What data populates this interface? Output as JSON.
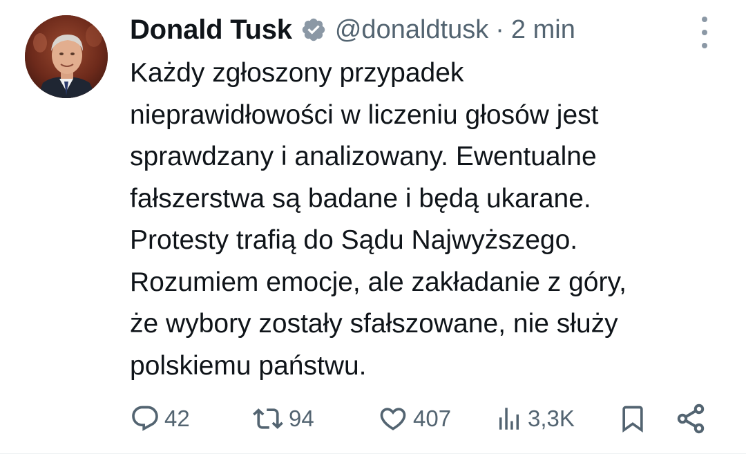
{
  "author": {
    "display_name": "Donald Tusk",
    "handle": "@donaldtusk",
    "separator": "·",
    "time": "2 min",
    "avatar_icon": "profile-photo",
    "verified_icon": "verified-badge-icon",
    "verified_color": "#8b98a5"
  },
  "tweet": {
    "text": "Każdy zgłoszony przypadek\nnieprawidłowości w liczeniu głosów jest\nsprawdzany i analizowany. Ewentualne\nfałszerstwa są badane i będą ukarane.\nProtesty trafią do Sądu Najwyższego.\nRozumiem emocje, ale zakładanie z góry,\nże wybory zostały sfałszowane, nie służy\npolskiemu państwu."
  },
  "actions": {
    "replies": {
      "icon": "reply-icon",
      "count": "42"
    },
    "reposts": {
      "icon": "repost-icon",
      "count": "94"
    },
    "likes": {
      "icon": "heart-icon",
      "count": "407"
    },
    "views": {
      "icon": "views-icon",
      "count": "3,3K"
    },
    "bookmark": {
      "icon": "bookmark-icon"
    },
    "share": {
      "icon": "share-icon"
    }
  },
  "colors": {
    "text": "#0f1419",
    "secondary": "#536471",
    "background": "#ffffff"
  }
}
